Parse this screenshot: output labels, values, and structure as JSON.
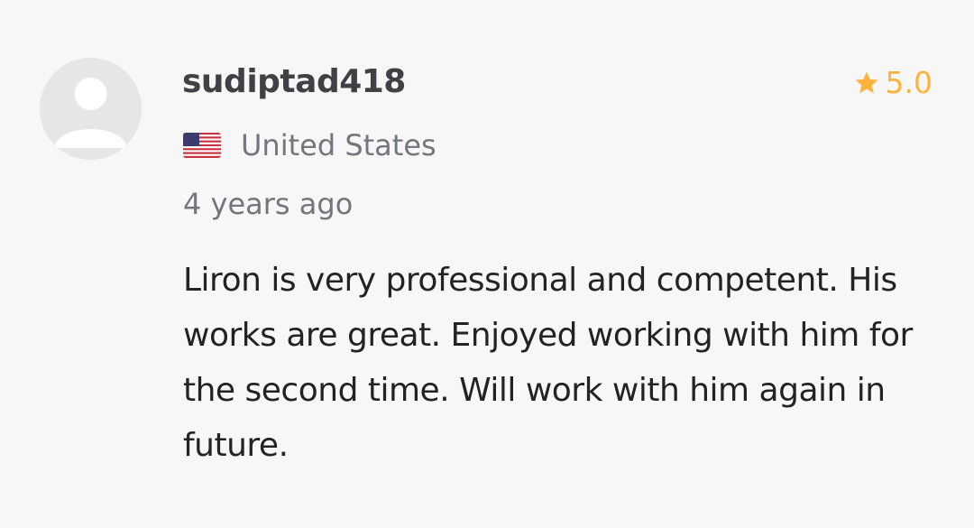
{
  "review": {
    "username": "sudiptad418",
    "country": "United States",
    "flag_icon": "us-flag-icon",
    "time_ago": "4 years ago",
    "rating": "5.0",
    "rating_icon": "star-icon",
    "text": "Liron is very professional and competent. His works are great. Enjoyed working with him for the second time. Will work with him again in future."
  },
  "colors": {
    "background": "#f7f7f7",
    "star": "#ffb33e",
    "username": "#404145",
    "secondary_text": "#74767e",
    "body_text": "#222325",
    "avatar": "#e6e6e8"
  }
}
